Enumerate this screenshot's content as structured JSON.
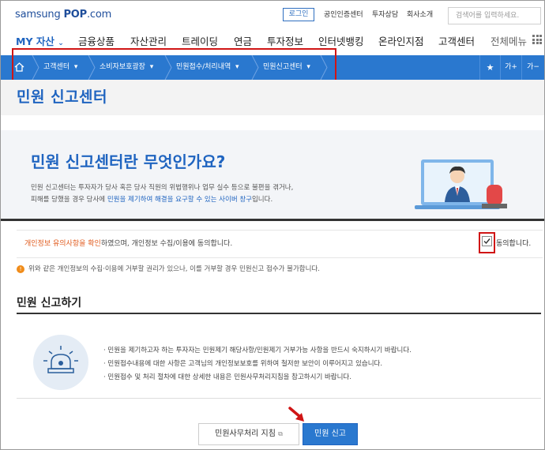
{
  "header": {
    "logo_pre": "samsung ",
    "logo_main": "POP",
    "logo_post": ".com",
    "login": "로그인",
    "util_links": [
      "공인인증센터",
      "투자상담",
      "회사소개"
    ],
    "search_placeholder": "검색어를 입력하세요."
  },
  "gnb": {
    "my_asset": "MY 자산",
    "my_asset_caret": "⌄",
    "items": [
      "금융상품",
      "자산관리",
      "트레이딩",
      "연금",
      "투자정보",
      "인터넷뱅킹",
      "온라인지점",
      "고객센터"
    ],
    "all_menu": "전체메뉴"
  },
  "breadcrumb": {
    "home_icon": "home-icon",
    "items": [
      "고객센터",
      "소비자보호광장",
      "민원접수/처리내역",
      "민원신고센터"
    ],
    "caret": "▾",
    "star": "★",
    "font_up": "가+",
    "font_down": "가−"
  },
  "page": {
    "title": "민원 신고센터"
  },
  "intro": {
    "title": "민원 신고센터란 무엇인가요?",
    "line1": "민원 신고센터는 투자자가 당사 혹은 당사 직원의 위법행위나 업무 실수 등으로 불편을 겪거나,",
    "line2_pre": "피해를 당했을 경우 당사에 ",
    "line2_hl": "민원을 제기하여 해결을 요구할 수 있는 사이버 창구",
    "line2_post": "입니다."
  },
  "consent": {
    "link": "개인정보 유의사항을 확인",
    "text": "하였으며, 개인정보 수집/이용에 동의합니다.",
    "checked": true,
    "label": "동의합니다."
  },
  "notice": {
    "icon": "!",
    "text": "위와 같은 개인정보의 수집·이용에 거부할 권리가 있으나, 이를 거부할 경우 민원신고 접수가 불가합니다."
  },
  "section": {
    "title": "민원 신고하기",
    "items": [
      "· 민원을 제기하고자 하는 투자자는 민원제기 해당사항/민원제기 거부가능 사항을 반드시 숙지하시기 바랍니다.",
      "· 민원접수내용에 대한 사항은 고객님의 개인정보보호를 위하여 철저한 보안이 이루어지고 있습니다.",
      "· 민원접수 및 처리 절차에 대한 상세한 내용은 민원사무처리지침을 참고하시기 바랍니다."
    ]
  },
  "buttons": {
    "guide": "민원사무처리 지침",
    "report": "민원 신고"
  },
  "colors": {
    "brand_blue": "#2a78cf",
    "title_blue": "#1f64c0",
    "highlight_red": "#d01515",
    "notice_orange": "#f08c1a"
  }
}
